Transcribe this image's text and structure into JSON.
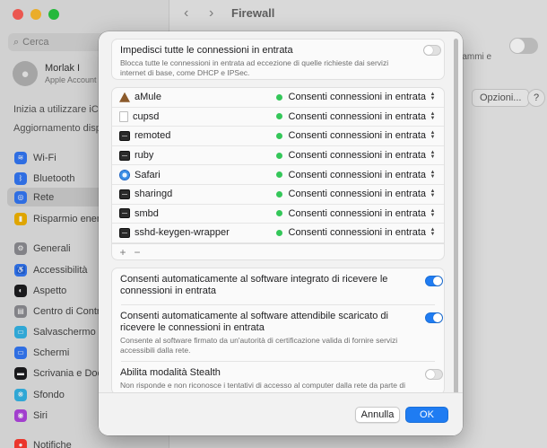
{
  "window": {
    "title": "Firewall",
    "search_placeholder": "Cerca",
    "profile_name": "Morlak I",
    "profile_subtitle": "Apple Account",
    "link_start": "Inizia a utilizzare iCloud",
    "link_updates": "Aggiornamento disponibile",
    "right_text": "rammi e",
    "options_button": "Opzioni...",
    "help_button": "?"
  },
  "sidebar": {
    "items": [
      {
        "label": "Wi-Fi",
        "icon": "wifi-icon",
        "color": "#3478f6",
        "glyph": "≋"
      },
      {
        "label": "Bluetooth",
        "icon": "bluetooth-icon",
        "color": "#3478f6",
        "glyph": "ᛒ"
      },
      {
        "label": "Rete",
        "icon": "network-icon",
        "color": "#3478f6",
        "glyph": "◎"
      },
      {
        "label": "Risparmio energia",
        "icon": "battery-icon",
        "color": "#f2b400",
        "glyph": "▮"
      },
      {
        "label": "Generali",
        "icon": "gear-icon",
        "color": "#8e8e93",
        "glyph": "⚙"
      },
      {
        "label": "Accessibilità",
        "icon": "accessibility-icon",
        "color": "#3478f6",
        "glyph": "♿"
      },
      {
        "label": "Aspetto",
        "icon": "appearance-icon",
        "color": "#1d1d1f",
        "glyph": "◐"
      },
      {
        "label": "Centro di Controllo",
        "icon": "control-center-icon",
        "color": "#8e8e93",
        "glyph": "▤"
      },
      {
        "label": "Salvaschermo",
        "icon": "screensaver-icon",
        "color": "#35b6e8",
        "glyph": "▭"
      },
      {
        "label": "Schermi",
        "icon": "displays-icon",
        "color": "#3478f6",
        "glyph": "▭"
      },
      {
        "label": "Scrivania e Dock",
        "icon": "dock-icon",
        "color": "#1d1d1f",
        "glyph": "▬"
      },
      {
        "label": "Sfondo",
        "icon": "wallpaper-icon",
        "color": "#35b6e8",
        "glyph": "❋"
      },
      {
        "label": "Siri",
        "icon": "siri-icon",
        "color": "#b045e0",
        "glyph": "◉"
      },
      {
        "label": "Notifiche",
        "icon": "notifications-icon",
        "color": "#ff3b30",
        "glyph": "●"
      }
    ]
  },
  "sheet": {
    "block_all": {
      "title": "Impedisci tutte le connessioni in entrata",
      "description": "Blocca tutte le connessioni in entrata ad eccezione di quelle richieste dai servizi internet di base, come DHCP e IPSec.",
      "enabled": false
    },
    "apps": [
      {
        "name": "aMule",
        "icon": "amule-icon",
        "status": "Consenti connessioni in entrata"
      },
      {
        "name": "cupsd",
        "icon": "document-icon",
        "status": "Consenti connessioni in entrata"
      },
      {
        "name": "remoted",
        "icon": "terminal-icon",
        "status": "Consenti connessioni in entrata"
      },
      {
        "name": "ruby",
        "icon": "terminal-icon",
        "status": "Consenti connessioni in entrata"
      },
      {
        "name": "Safari",
        "icon": "safari-icon",
        "status": "Consenti connessioni in entrata"
      },
      {
        "name": "sharingd",
        "icon": "terminal-icon",
        "status": "Consenti connessioni in entrata"
      },
      {
        "name": "smbd",
        "icon": "terminal-icon",
        "status": "Consenti connessioni in entrata"
      },
      {
        "name": "sshd-keygen-wrapper",
        "icon": "terminal-icon",
        "status": "Consenti connessioni in entrata"
      }
    ],
    "list_add": "+",
    "list_remove": "−",
    "auto_builtin": {
      "title": "Consenti automaticamente al software integrato di ricevere le connessioni in entrata",
      "enabled": true
    },
    "auto_signed": {
      "title": "Consenti automaticamente al software attendibile scaricato di ricevere le connessioni in entrata",
      "description": "Consente al software firmato da un'autorità di certificazione valida di fornire servizi accessibili dalla rete.",
      "enabled": true
    },
    "stealth": {
      "title": "Abilita modalità Stealth",
      "description": "Non risponde e non riconosce i tentativi di accesso al computer dalla rete da parte di applicazioni di test che utilizzano ICMP, come Ping.",
      "enabled": false
    },
    "cancel_label": "Annulla",
    "ok_label": "OK"
  }
}
